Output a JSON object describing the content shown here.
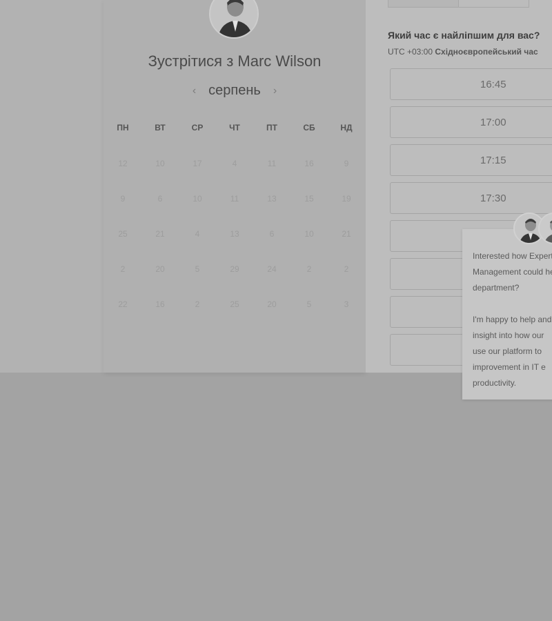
{
  "calendar": {
    "title": "Зустрітися з Marc Wilson",
    "month": "серпень",
    "prev_icon": "‹",
    "next_icon": "›",
    "weekdays": [
      "ПН",
      "ВТ",
      "СР",
      "ЧТ",
      "ПТ",
      "СБ",
      "НД"
    ],
    "days": [
      [
        "12",
        "10",
        "17",
        "4",
        "11",
        "16",
        "9"
      ],
      [
        "9",
        "6",
        "10",
        "11",
        "13",
        "15",
        "19"
      ],
      [
        "25",
        "21",
        "4",
        "13",
        "6",
        "10",
        "21"
      ],
      [
        "2",
        "20",
        "5",
        "29",
        "24",
        "2",
        "2"
      ],
      [
        "22",
        "16",
        "2",
        "25",
        "20",
        "5",
        "3"
      ]
    ]
  },
  "timepicker": {
    "question": "Який час є найліпшим для вас?",
    "timezone_offset": "UTC +03:00",
    "timezone_name": "Східноєвропейський час",
    "slots": [
      "16:45",
      "17:00",
      "17:15",
      "17:30",
      "",
      "",
      ""
    ]
  },
  "chat": {
    "message": "Interested how Expert\nManagement could help\ndepartment?\n\nI'm happy to help and\ninsight into how our\nuse our platform to\nimprovement in IT e\nproductivity."
  }
}
